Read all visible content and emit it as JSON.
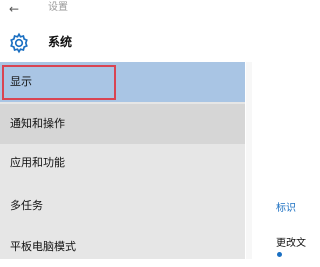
{
  "window": {
    "title": "设置",
    "back_icon": "back-arrow-icon"
  },
  "header": {
    "title": "系统",
    "icon": "gear-icon"
  },
  "sidebar": {
    "items": [
      {
        "label": "显示",
        "state": "selected"
      },
      {
        "label": "通知和操作",
        "state": "hover"
      },
      {
        "label": "应用和功能",
        "state": "normal"
      },
      {
        "label": "多任务",
        "state": "normal"
      },
      {
        "label": "平板电脑模式",
        "state": "normal"
      }
    ]
  },
  "content": {
    "link_text": "标识",
    "text": "更改文"
  },
  "colors": {
    "selected_bg": "#a9c5e4",
    "hover_bg": "#d6d6d6",
    "sidebar_bg": "#e6e6e6",
    "highlight_border": "#d94452",
    "accent": "#1a6fc2"
  }
}
